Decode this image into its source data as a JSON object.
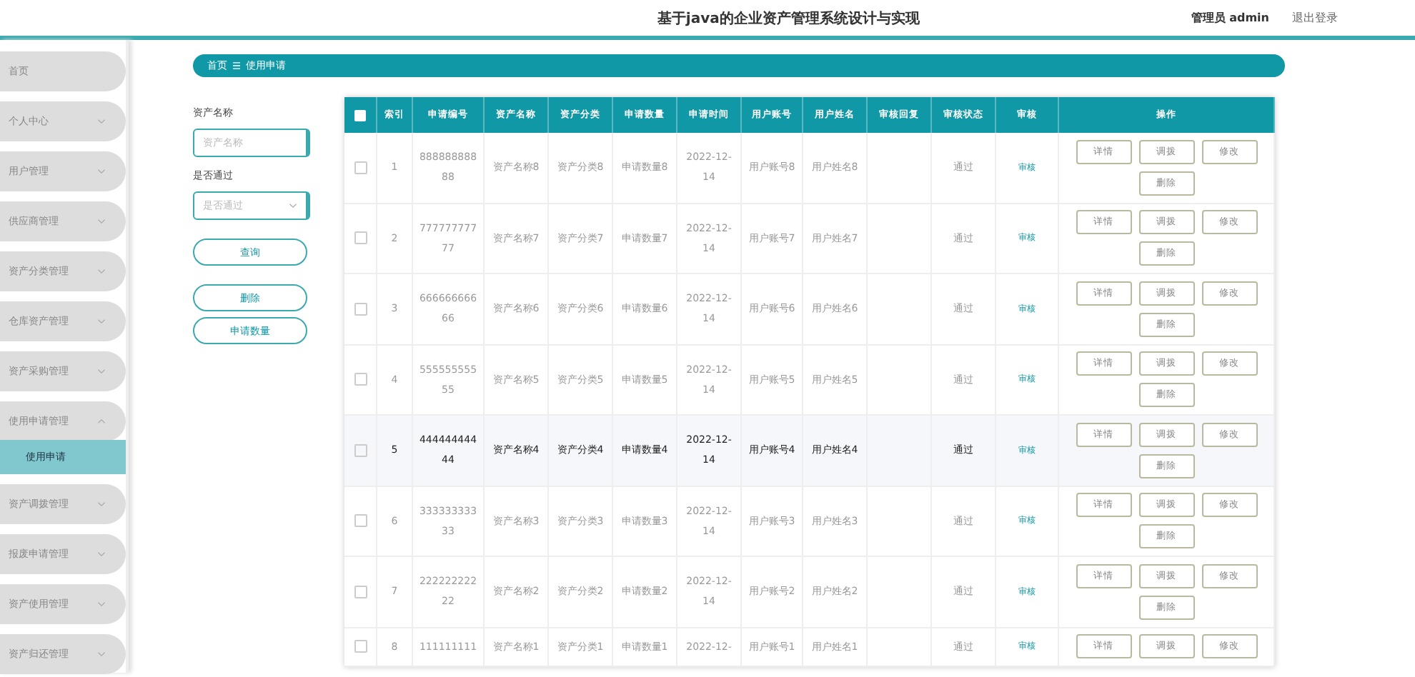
{
  "header": {
    "title": "基于java的企业资产管理系统设计与实现",
    "user": "管理员 admin",
    "logout": "退出登录"
  },
  "sidebar": {
    "items": [
      {
        "label": "首页",
        "has_children": false
      },
      {
        "label": "个人中心",
        "expanded": false,
        "has_children": true
      },
      {
        "label": "用户管理",
        "expanded": false,
        "has_children": true
      },
      {
        "label": "供应商管理",
        "expanded": false,
        "has_children": true
      },
      {
        "label": "资产分类管理",
        "expanded": false,
        "has_children": true
      },
      {
        "label": "仓库资产管理",
        "expanded": false,
        "has_children": true
      },
      {
        "label": "资产采购管理",
        "expanded": false,
        "has_children": true
      },
      {
        "label": "使用申请管理",
        "expanded": true,
        "has_children": true,
        "children": [
          {
            "label": "使用申请",
            "selected": true
          }
        ]
      },
      {
        "label": "资产调拨管理",
        "expanded": false,
        "has_children": true
      },
      {
        "label": "报废申请管理",
        "expanded": false,
        "has_children": true
      },
      {
        "label": "资产使用管理",
        "expanded": false,
        "has_children": true
      },
      {
        "label": "资产归还管理",
        "expanded": false,
        "has_children": true
      }
    ]
  },
  "breadcrumb": [
    "首页",
    "使用申请"
  ],
  "search": {
    "fields": [
      {
        "kind": "input",
        "label": "资产名称",
        "placeholder": "资产名称"
      },
      {
        "kind": "select",
        "label": "是否通过",
        "placeholder": "是否通过"
      }
    ],
    "buttons": [
      "查询",
      "删除",
      "申请数量"
    ]
  },
  "table": {
    "select_all": {
      "checked": false
    },
    "columns": [
      "索引",
      "申请编号",
      "资产名称",
      "资产分类",
      "申请数量",
      "申请时间",
      "用户账号",
      "用户姓名",
      "审核回复",
      "审核状态",
      "审核",
      "操作"
    ],
    "rows": [
      {
        "checked": false,
        "highlighted": false,
        "cells": [
          "1",
          "88888888888",
          "资产名称8",
          "资产分类8",
          "申请数量8",
          "2022-12-14",
          "用户账号8",
          "用户姓名8",
          "",
          "通过"
        ],
        "review": "审核",
        "actions": [
          "详情",
          "调拨",
          "修改",
          "删除"
        ]
      },
      {
        "checked": false,
        "highlighted": false,
        "cells": [
          "2",
          "77777777777",
          "资产名称7",
          "资产分类7",
          "申请数量7",
          "2022-12-14",
          "用户账号7",
          "用户姓名7",
          "",
          "通过"
        ],
        "review": "审核",
        "actions": [
          "详情",
          "调拨",
          "修改",
          "删除"
        ]
      },
      {
        "checked": false,
        "highlighted": false,
        "cells": [
          "3",
          "66666666666",
          "资产名称6",
          "资产分类6",
          "申请数量6",
          "2022-12-14",
          "用户账号6",
          "用户姓名6",
          "",
          "通过"
        ],
        "review": "审核",
        "actions": [
          "详情",
          "调拨",
          "修改",
          "删除"
        ]
      },
      {
        "checked": false,
        "highlighted": false,
        "cells": [
          "4",
          "55555555555",
          "资产名称5",
          "资产分类5",
          "申请数量5",
          "2022-12-14",
          "用户账号5",
          "用户姓名5",
          "",
          "通过"
        ],
        "review": "审核",
        "actions": [
          "详情",
          "调拨",
          "修改",
          "删除"
        ]
      },
      {
        "checked": false,
        "highlighted": true,
        "cells": [
          "5",
          "44444444444",
          "资产名称4",
          "资产分类4",
          "申请数量4",
          "2022-12-14",
          "用户账号4",
          "用户姓名4",
          "",
          "通过"
        ],
        "review": "审核",
        "actions": [
          "详情",
          "调拨",
          "修改",
          "删除"
        ]
      },
      {
        "checked": false,
        "highlighted": false,
        "cells": [
          "6",
          "33333333333",
          "资产名称3",
          "资产分类3",
          "申请数量3",
          "2022-12-14",
          "用户账号3",
          "用户姓名3",
          "",
          "通过"
        ],
        "review": "审核",
        "actions": [
          "详情",
          "调拨",
          "修改",
          "删除"
        ]
      },
      {
        "checked": false,
        "highlighted": false,
        "cells": [
          "7",
          "22222222222",
          "资产名称2",
          "资产分类2",
          "申请数量2",
          "2022-12-14",
          "用户账号2",
          "用户姓名2",
          "",
          "通过"
        ],
        "review": "审核",
        "actions": [
          "详情",
          "调拨",
          "修改",
          "删除"
        ]
      },
      {
        "checked": false,
        "highlighted": false,
        "cells": [
          "8",
          "111111111",
          "资产名称1",
          "资产分类1",
          "申请数量1",
          "2022-12-",
          "用户账号1",
          "用户姓名1",
          "",
          "通过"
        ],
        "review": "审核",
        "actions": [
          "详情",
          "调拨",
          "修改"
        ]
      }
    ]
  }
}
